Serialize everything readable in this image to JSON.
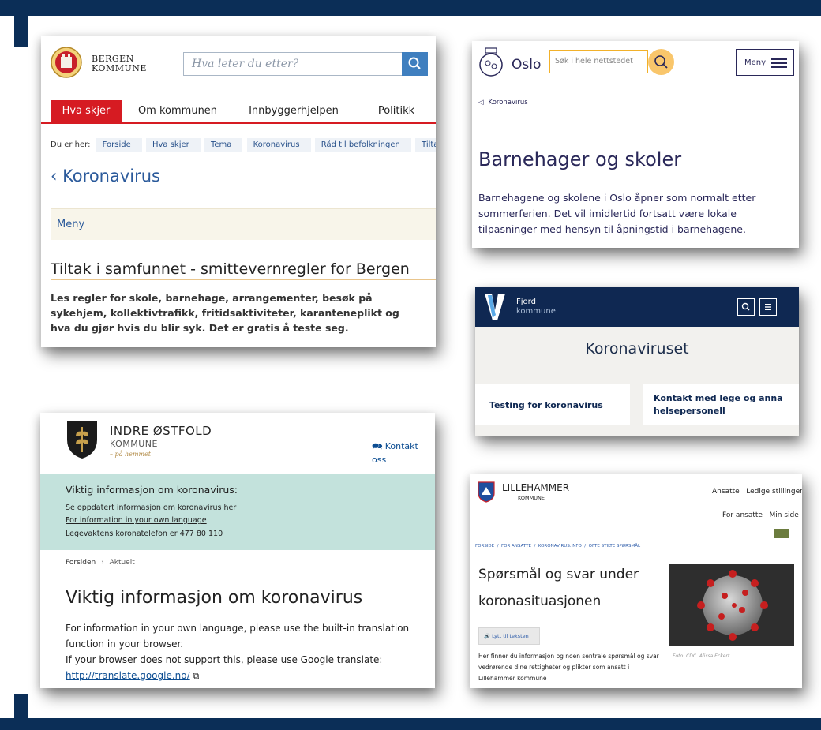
{
  "bergen": {
    "logo_line1": "BERGEN",
    "logo_line2": "KOMMUNE",
    "search_placeholder": "Hva leter du etter?",
    "nav": [
      "Hva skjer",
      "Om kommunen",
      "Innbyggerhjelpen",
      "Politikk"
    ],
    "breadcrumb_prefix": "Du er her:",
    "breadcrumbs": [
      "Forside",
      "Hva skjer",
      "Tema",
      "Koronavirus",
      "Råd til befolkningen",
      "Tiltak i s"
    ],
    "back_title": "‹ Koronavirus",
    "menu_label": "Meny",
    "heading": "Tiltak i samfunnet - smittevernregler for Bergen",
    "description": "Les regler for skole, barnehage, arrangementer, besøk på sykehjem, kollektivtrafikk, fritidsaktiviteter, karanteneplikt og hva du gjør hvis du blir syk. Det er gratis å teste seg."
  },
  "oslo": {
    "name": "Oslo",
    "search_placeholder": "Søk i hele nettstedet",
    "menu_label": "Meny",
    "breadcrumb": "Koronavirus",
    "title": "Barnehager og skoler",
    "body": "Barnehagene og skolene i Oslo åpner som normalt etter sommerferien. Det vil imidlertid fortsatt være lokale tilpasninger med hensyn til åpningstid i barnehagene."
  },
  "fjord": {
    "name1": "Fjord",
    "name2": "kommune",
    "title": "Koronaviruset",
    "box1": "Testing for koronavirus",
    "box2": "Kontakt med lege og anna helsepersonell"
  },
  "indre": {
    "name1": "INDRE ØSTFOLD",
    "name2": "KOMMUNE",
    "tagline": "– på hemmet",
    "contact": "Kontakt oss",
    "band_title": "Viktig informasjon om koronavirus:",
    "link1": "Se oppdatert informasjon om koronavirus her",
    "link2": "For information in your own language",
    "phone_prefix": "Legevaktens koronatelefon er",
    "phone": "477 80 110",
    "crumb_home": "Forsiden",
    "crumb_sep": "›",
    "crumb_current": "Aktuelt",
    "heading": "Viktig informasjon om koronavirus",
    "p1": "For information in your own language, please use the built-in translation function in your browser.",
    "p2": "If your browser does not support this, please use Google translate:",
    "url": "http://translate.google.no/"
  },
  "lille": {
    "name1": "LILLEHAMMER",
    "name2": "KOMMUNE",
    "top_links": "Ansatte   Ledige stillinger",
    "sub_links": "For ansatte   Min side",
    "breadcrumbs": "FORSIDE  /  FOR ANSATTE  /  KORONAVIRUS.INFO  /  OFTE STILTE SPØRSMÅL",
    "title": "Spørsmål og svar under koronasituasjonen",
    "listen": "🔊 Lytt til teksten",
    "body": "Her finner du informasjon og noen sentrale spørsmål og svar vedrørende dine rettigheter og plikter som ansatt i Lillehammer kommune",
    "caption": "Foto: CDC. Alissa Eckert"
  }
}
